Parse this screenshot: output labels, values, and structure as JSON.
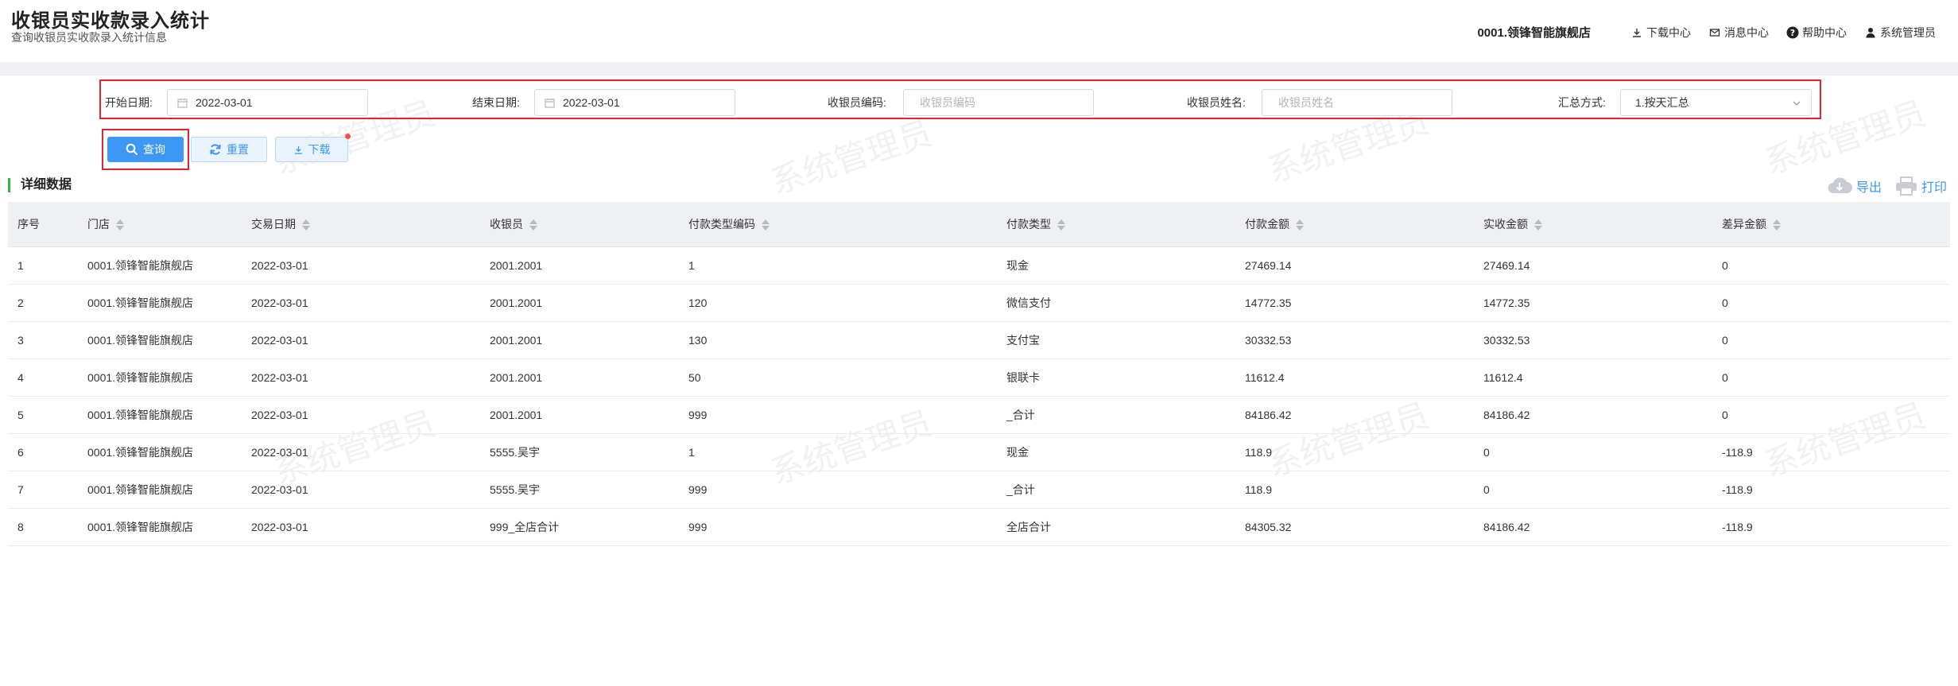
{
  "header": {
    "title": "收银员实收款录入统计",
    "subtitle": "查询收银员实收款录入统计信息",
    "store": "0001.领锋智能旗舰店",
    "nav": [
      {
        "label": "下载中心",
        "icon": "download-icon"
      },
      {
        "label": "消息中心",
        "icon": "mail-icon"
      },
      {
        "label": "帮助中心",
        "icon": "help-icon"
      },
      {
        "label": "系统管理员",
        "icon": "user-icon"
      }
    ]
  },
  "filters": {
    "start_label": "开始日期:",
    "start_value": "2022-03-01",
    "end_label": "结束日期:",
    "end_value": "2022-03-01",
    "cashier_code_label": "收银员编码:",
    "cashier_code_placeholder": "收银员编码",
    "cashier_name_label": "收银员姓名:",
    "cashier_name_placeholder": "收银员姓名",
    "summary_label": "汇总方式:",
    "summary_value": "1.按天汇总"
  },
  "buttons": {
    "query": "查询",
    "reset": "重置",
    "download": "下载"
  },
  "section": {
    "title": "详细数据",
    "export": "导出",
    "print": "打印"
  },
  "table": {
    "columns": [
      "序号",
      "门店",
      "交易日期",
      "收银员",
      "付款类型编码",
      "付款类型",
      "付款金额",
      "实收金额",
      "差异金额"
    ],
    "rows": [
      [
        "1",
        "0001.领锋智能旗舰店",
        "2022-03-01",
        "2001.2001",
        "1",
        "现金",
        "27469.14",
        "27469.14",
        "0"
      ],
      [
        "2",
        "0001.领锋智能旗舰店",
        "2022-03-01",
        "2001.2001",
        "120",
        "微信支付",
        "14772.35",
        "14772.35",
        "0"
      ],
      [
        "3",
        "0001.领锋智能旗舰店",
        "2022-03-01",
        "2001.2001",
        "130",
        "支付宝",
        "30332.53",
        "30332.53",
        "0"
      ],
      [
        "4",
        "0001.领锋智能旗舰店",
        "2022-03-01",
        "2001.2001",
        "50",
        "银联卡",
        "11612.4",
        "11612.4",
        "0"
      ],
      [
        "5",
        "0001.领锋智能旗舰店",
        "2022-03-01",
        "2001.2001",
        "999",
        "_合计",
        "84186.42",
        "84186.42",
        "0"
      ],
      [
        "6",
        "0001.领锋智能旗舰店",
        "2022-03-01",
        "5555.吴宇",
        "1",
        "现金",
        "118.9",
        "0",
        "-118.9"
      ],
      [
        "7",
        "0001.领锋智能旗舰店",
        "2022-03-01",
        "5555.吴宇",
        "999",
        "_合计",
        "118.9",
        "0",
        "-118.9"
      ],
      [
        "8",
        "0001.领锋智能旗舰店",
        "2022-03-01",
        "999_全店合计",
        "999",
        "全店合计",
        "84305.32",
        "84186.42",
        "-118.9"
      ]
    ]
  },
  "watermark": "系统管理员",
  "colors": {
    "primary": "#3d97f5",
    "highlight_border": "#e0262f",
    "section_accent": "#38b24a",
    "header_row_bg": "#eef0f4"
  }
}
